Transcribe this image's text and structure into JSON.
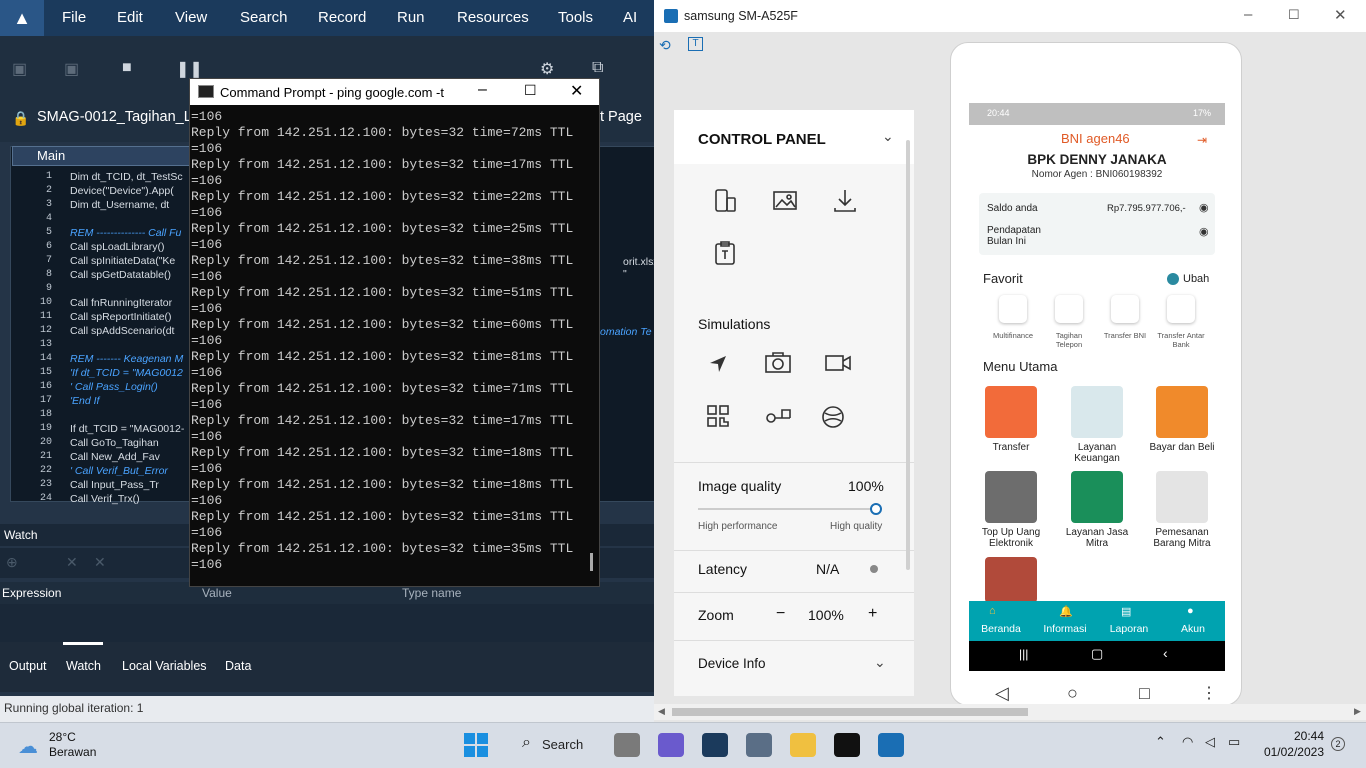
{
  "ide": {
    "menu": [
      "File",
      "Edit",
      "View",
      "Search",
      "Record",
      "Run",
      "Resources",
      "Tools",
      "AI"
    ],
    "doc_title": "SMAG-0012_Tagihan_Li",
    "doc_title_suffix": "t Page",
    "editor_tab": "Main",
    "code_lines": [
      {
        "n": "1",
        "text": "Dim dt_TCID, dt_TestSc",
        "type": "code"
      },
      {
        "n": "2",
        "text": "Device(\"Device\").App(",
        "type": "code"
      },
      {
        "n": "3",
        "text": "Dim dt_Username, dt",
        "type": "code"
      },
      {
        "n": "4",
        "text": "",
        "type": "code"
      },
      {
        "n": "5",
        "text": "REM -------------- Call Fu",
        "type": "rem"
      },
      {
        "n": "6",
        "text": "Call spLoadLibrary()",
        "type": "code"
      },
      {
        "n": "7",
        "text": "Call spInitiateData(\"Ke",
        "type": "code"
      },
      {
        "n": "8",
        "text": "Call spGetDatatable()",
        "type": "code"
      },
      {
        "n": "9",
        "text": "",
        "type": "code"
      },
      {
        "n": "10",
        "text": "Call fnRunningIterator",
        "type": "code"
      },
      {
        "n": "11",
        "text": "Call spReportInitiate()",
        "type": "code"
      },
      {
        "n": "12",
        "text": "Call spAddScenario(dt",
        "type": "code"
      },
      {
        "n": "13",
        "text": "",
        "type": "code"
      },
      {
        "n": "14",
        "text": "REM ------- Keagenan M",
        "type": "rem"
      },
      {
        "n": "15",
        "text": "'If dt_TCID = \"MAG0012",
        "type": "rem"
      },
      {
        "n": "16",
        "text": "'     Call Pass_Login()",
        "type": "rem"
      },
      {
        "n": "17",
        "text": "'End If",
        "type": "rem"
      },
      {
        "n": "18",
        "text": "",
        "type": "code"
      },
      {
        "n": "19",
        "text": "If dt_TCID = \"MAG0012-",
        "type": "code"
      },
      {
        "n": "20",
        "text": "     Call GoTo_Tagihan",
        "type": "code"
      },
      {
        "n": "21",
        "text": "     Call New_Add_Fav",
        "type": "code"
      },
      {
        "n": "22",
        "text": "'     Call Verif_But_Error",
        "type": "rem"
      },
      {
        "n": "23",
        "text": "     Call Input_Pass_Tr",
        "type": "code"
      },
      {
        "n": "24",
        "text": "     Call Verif_Trx()",
        "type": "code"
      }
    ],
    "right_fragments": [
      "orit.xlsx\", \"",
      "omation Te"
    ],
    "watch_label": "Watch",
    "watch_cols": {
      "expression": "Expression",
      "value": "Value",
      "type": "Type name"
    },
    "bottom_tabs": [
      "Output",
      "Watch",
      "Local Variables",
      "Data"
    ],
    "status": "Running global iteration: 1"
  },
  "cmd": {
    "title": "Command Prompt - ping  google.com -t",
    "lines": [
      "=106",
      "Reply from 142.251.12.100: bytes=32 time=72ms TTL",
      "=106",
      "Reply from 142.251.12.100: bytes=32 time=17ms TTL",
      "=106",
      "Reply from 142.251.12.100: bytes=32 time=22ms TTL",
      "=106",
      "Reply from 142.251.12.100: bytes=32 time=25ms TTL",
      "=106",
      "Reply from 142.251.12.100: bytes=32 time=38ms TTL",
      "=106",
      "Reply from 142.251.12.100: bytes=32 time=51ms TTL",
      "=106",
      "Reply from 142.251.12.100: bytes=32 time=60ms TTL",
      "=106",
      "Reply from 142.251.12.100: bytes=32 time=81ms TTL",
      "=106",
      "Reply from 142.251.12.100: bytes=32 time=71ms TTL",
      "=106",
      "Reply from 142.251.12.100: bytes=32 time=17ms TTL",
      "=106",
      "Reply from 142.251.12.100: bytes=32 time=18ms TTL",
      "=106",
      "Reply from 142.251.12.100: bytes=32 time=18ms TTL",
      "=106",
      "Reply from 142.251.12.100: bytes=32 time=31ms TTL",
      "=106",
      "Reply from 142.251.12.100: bytes=32 time=35ms TTL",
      "=106"
    ]
  },
  "device": {
    "title": "samsung SM-A525F",
    "control_panel": {
      "title": "CONTROL PANEL",
      "simulations_label": "Simulations",
      "image_quality_label": "Image quality",
      "image_quality_value": "100%",
      "image_quality_level": 1.0,
      "high_performance": "High performance",
      "high_quality": "High quality",
      "latency_label": "Latency",
      "latency_value": "N/A",
      "zoom_label": "Zoom",
      "zoom_value": "100%",
      "zoom_minus": "−",
      "zoom_plus": "+",
      "device_info": "Device Info"
    },
    "phone": {
      "status_time": "20:44",
      "status_battery": "17%",
      "brand": "BNI agen46",
      "agent_name": "BPK DENNY JANAKA",
      "agent_number": "Nomor Agen : BNI060198392",
      "saldo_label": "Saldo anda",
      "saldo_value": "Rp7.795.977.706,-",
      "pendapatan_label_1": "Pendapatan",
      "pendapatan_label_2": "Bulan Ini",
      "favorit_label": "Favorit",
      "ubah_label": "Ubah",
      "favorites": [
        "Multifinance",
        "Tagihan Telepon",
        "Transfer BNI",
        "Transfer Antar Bank"
      ],
      "menu_utama": "Menu Utama",
      "menu_items": [
        {
          "label": "Transfer",
          "color": "#f26b3a"
        },
        {
          "label": "Layanan Keuangan",
          "color": "#d9e8ec"
        },
        {
          "label": "Bayar dan Beli",
          "color": "#f08a2b"
        },
        {
          "label": "Top Up Uang Elektronik",
          "color": "#6d6d6d"
        },
        {
          "label": "Layanan Jasa Mitra",
          "color": "#1a8f5a"
        },
        {
          "label": "Pemesanan Barang Mitra",
          "color": "#e4e4e4"
        }
      ],
      "nav": [
        "Beranda",
        "Informasi",
        "Laporan",
        "Akun"
      ]
    }
  },
  "taskbar": {
    "temp": "28°C",
    "weather": "Berawan",
    "search": "Search",
    "time": "20:44",
    "date": "01/02/2023",
    "notif_count": "2"
  }
}
